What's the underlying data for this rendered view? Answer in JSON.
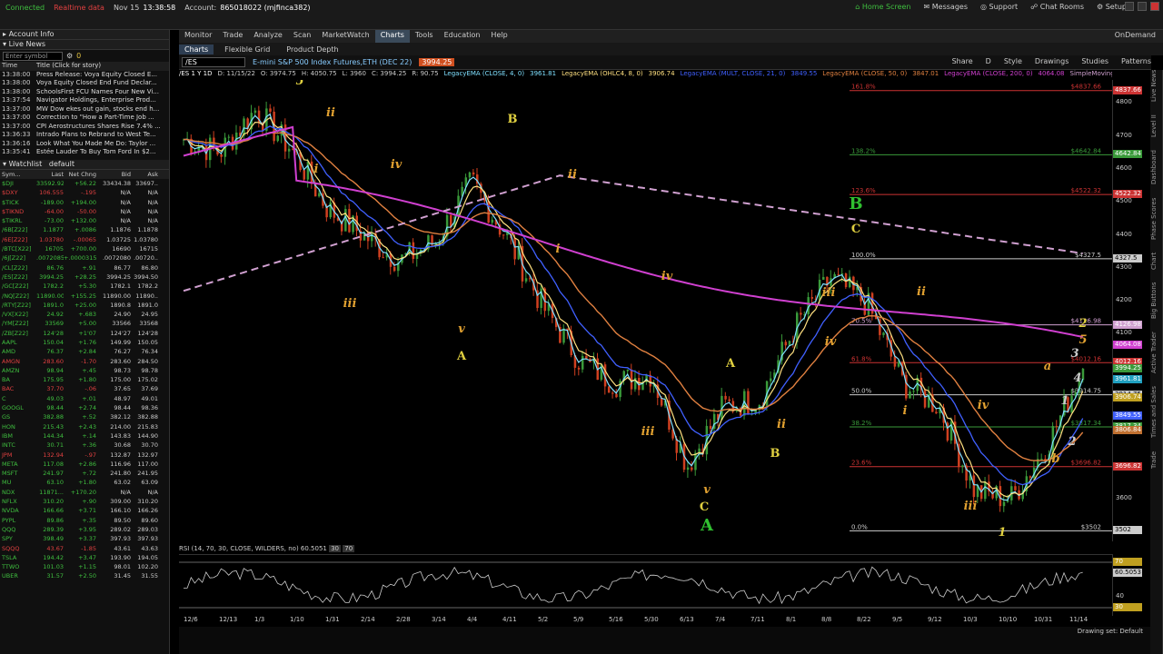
{
  "topbar": {
    "connected": "Connected",
    "realtime": "Realtime data",
    "date": "Nov 15",
    "time": "13:38:58",
    "account_label": "Account:",
    "account": "865018022 (mjfinca382)",
    "home": "Home Screen",
    "messages": "Messages",
    "support": "Support",
    "chat": "Chat Rooms",
    "setup": "Setup"
  },
  "menu": {
    "items": [
      "Monitor",
      "Trade",
      "Analyze",
      "Scan",
      "MarketWatch",
      "Charts",
      "Tools",
      "Education",
      "Help"
    ],
    "active": "Charts",
    "ondemand": "OnDemand"
  },
  "subtabs": {
    "items": [
      "Charts",
      "Flexible Grid",
      "Product Depth"
    ]
  },
  "charttool": {
    "symbol": "/ES",
    "desc": "E-mini S&P 500 Index Futures,ETH (DEC 22)",
    "price": "3994.25",
    "buttons": [
      "Share",
      "D",
      "Style",
      "Drawings",
      "Studies",
      "Patterns"
    ]
  },
  "legend": [
    {
      "t": "/ES 1 Y 1D",
      "c": "#ffffff"
    },
    {
      "t": "D: 11/15/22",
      "c": "#cccccc"
    },
    {
      "t": "O: 3974.75",
      "c": "#cccccc"
    },
    {
      "t": "H: 4050.75",
      "c": "#cccccc"
    },
    {
      "t": "L: 3960",
      "c": "#cccccc"
    },
    {
      "t": "C: 3994.25",
      "c": "#cccccc"
    },
    {
      "t": "R: 90.75",
      "c": "#cccccc"
    },
    {
      "t": "LegacyEMA (CLOSE, 4, 0)",
      "c": "#7fe0ff"
    },
    {
      "t": "3961.81",
      "c": "#7fe0ff"
    },
    {
      "t": "LegacyEMA (OHLC4, 8, 0)",
      "c": "#ffe080"
    },
    {
      "t": "3906.74",
      "c": "#ffe080"
    },
    {
      "t": "LegacyEMA (MULT, CLOSE, 21, 0)",
      "c": "#4060ff"
    },
    {
      "t": "3849.55",
      "c": "#4060ff"
    },
    {
      "t": "LegacyEMA (CLOSE, 50, 0)",
      "c": "#e08040"
    },
    {
      "t": "3847.01",
      "c": "#e08040"
    },
    {
      "t": "LegacyEMA (CLOSE, 200, 0)",
      "c": "#d040d0"
    },
    {
      "t": "4064.08",
      "c": "#d040d0"
    },
    {
      "t": "SimpleMovingAvg (CLOSE, 200, 0, no)",
      "c": "#d0a0d0"
    },
    {
      "t": "4126.98",
      "c": "#d0a0d0"
    }
  ],
  "accountinfo": "Account Info",
  "livenews": {
    "title": "Live News",
    "entersymbol": "Enter symbol",
    "count": "0",
    "col_time": "Time",
    "col_title": "Title (Click for story)",
    "rows": [
      [
        "13:38:00",
        "Press Release: Voya Equity Closed E..."
      ],
      [
        "13:38:00",
        "Voya Equity Closed End Fund Declar..."
      ],
      [
        "13:38:00",
        "SchoolsFirst FCU Names Four New Vi..."
      ],
      [
        "13:37:54",
        "Navigator Holdings, Enterprise Prod..."
      ],
      [
        "13:37:00",
        "MW Dow ekes out gain, stocks end h..."
      ],
      [
        "13:37:00",
        "Correction to \"How a Part-Time Job ..."
      ],
      [
        "13:37:00",
        "CPI Aerostructures Shares Rise 7.4% ..."
      ],
      [
        "13:36:33",
        "Intrado Plans to Rebrand to West Te..."
      ],
      [
        "13:36:16",
        "Look What You Made Me Do: Taylor ..."
      ],
      [
        "13:35:41",
        "Estée Lauder To Buy Tom Ford In $2..."
      ]
    ]
  },
  "watchlist": {
    "title": "Watchlist",
    "name": "default",
    "cols": [
      "Sym...",
      "Last",
      "Net Chng",
      "Bid",
      "Ask"
    ],
    "rows": [
      [
        "$DJI",
        "33592.92",
        "+56.22",
        "33434.38",
        "33697.."
      ],
      [
        "$DXY",
        "106.555",
        "-.195",
        "N/A",
        "N/A"
      ],
      [
        "$TICK",
        "-189.00",
        "+194.00",
        "N/A",
        "N/A"
      ],
      [
        "$TIKND",
        "-64.00",
        "-50.00",
        "N/A",
        "N/A"
      ],
      [
        "$TIKRL",
        "-73.00",
        "+132.00",
        "N/A",
        "N/A"
      ],
      [
        "/6B[Z22]",
        "1.1877",
        "+.0086",
        "1.1876",
        "1.1878"
      ],
      [
        "/6E[Z22]",
        "1.03780",
        "-.00065",
        "1.03725",
        "1.03780"
      ],
      [
        "/BTC[X22]",
        "16705",
        "+700.00",
        "16690",
        "16715"
      ],
      [
        "/6J[Z22]",
        ".0072085",
        "+.0000315",
        ".0072080",
        ".00720.."
      ],
      [
        "/CL[Z22]",
        "86.76",
        "+.91",
        "86.77",
        "86.80"
      ],
      [
        "/ES[Z22]",
        "3994.25",
        "+28.25",
        "3994.25",
        "3994.50"
      ],
      [
        "/GC[Z22]",
        "1782.2",
        "+5.30",
        "1782.1",
        "1782.2"
      ],
      [
        "/NQ[Z22]",
        "11890.00",
        "+155.25",
        "11890.00",
        "11890.."
      ],
      [
        "/RTY[Z22]",
        "1891.0",
        "+25.00",
        "1890.8",
        "1891.0"
      ],
      [
        "/VX[X22]",
        "24.92",
        "+.683",
        "24.90",
        "24.95"
      ],
      [
        "/YM[Z22]",
        "33569",
        "+5.00",
        "33566",
        "33568"
      ],
      [
        "/ZB[Z22]",
        "124'28",
        "+1'07",
        "124'27",
        "124'28"
      ],
      [
        "AAPL",
        "150.04",
        "+1.76",
        "149.99",
        "150.05"
      ],
      [
        "AMD",
        "76.37",
        "+2.84",
        "76.27",
        "76.34"
      ],
      [
        "AMGN",
        "283.60",
        "-1.70",
        "283.60",
        "284.50"
      ],
      [
        "AMZN",
        "98.94",
        "+.45",
        "98.73",
        "98.78"
      ],
      [
        "BA",
        "175.95",
        "+1.80",
        "175.00",
        "175.02"
      ],
      [
        "BAC",
        "37.70",
        "-.06",
        "37.65",
        "37.69"
      ],
      [
        "C",
        "49.03",
        "+.01",
        "48.97",
        "49.01"
      ],
      [
        "GOOGL",
        "98.44",
        "+2.74",
        "98.44",
        "98.36"
      ],
      [
        "GS",
        "382.88",
        "+.52",
        "382.12",
        "382.88"
      ],
      [
        "HON",
        "215.43",
        "+2.43",
        "214.00",
        "215.83"
      ],
      [
        "IBM",
        "144.34",
        "+.14",
        "143.83",
        "144.90"
      ],
      [
        "INTC",
        "30.71",
        "+.36",
        "30.68",
        "30.70"
      ],
      [
        "JPM",
        "132.94",
        "-.97",
        "132.87",
        "132.97"
      ],
      [
        "META",
        "117.08",
        "+2.86",
        "116.96",
        "117.00"
      ],
      [
        "MSFT",
        "241.97",
        "+.72",
        "241.80",
        "241.95"
      ],
      [
        "MU",
        "63.10",
        "+1.80",
        "63.02",
        "63.09"
      ],
      [
        "NDX",
        "11871...",
        "+170.20",
        "N/A",
        "N/A"
      ],
      [
        "NFLX",
        "310.20",
        "+.90",
        "309.00",
        "310.20"
      ],
      [
        "NVDA",
        "166.66",
        "+3.71",
        "166.10",
        "166.26"
      ],
      [
        "PYPL",
        "89.86",
        "+.35",
        "89.50",
        "89.60"
      ],
      [
        "QQQ",
        "289.39",
        "+3.95",
        "289.02",
        "289.03"
      ],
      [
        "SPY",
        "398.49",
        "+3.37",
        "397.93",
        "397.93"
      ],
      [
        "SQQQ",
        "43.67",
        "-1.85",
        "43.61",
        "43.63"
      ],
      [
        "TSLA",
        "194.42",
        "+3.47",
        "193.90",
        "194.05"
      ],
      [
        "TTWO",
        "101.03",
        "+1.15",
        "98.01",
        "102.20"
      ],
      [
        "UBER",
        "31.57",
        "+2.50",
        "31.45",
        "31.55"
      ]
    ]
  },
  "rightstrip": [
    "Trade",
    "Times and Sales",
    "Active Trader",
    "Big Buttons",
    "Chart",
    "Phase Scores",
    "Dashboard",
    "Level II",
    "Live News"
  ],
  "yaxis": {
    "ticks": [
      "4800",
      "4700",
      "4600",
      "4500",
      "4400",
      "4300",
      "4200",
      "4100",
      "4000",
      "3900",
      "3800",
      "3700",
      "3600",
      "3500"
    ],
    "badges": [
      {
        "t": "4837.66",
        "c": "#cc3333",
        "y": 4837.66
      },
      {
        "t": "4642.84",
        "c": "#3a9a3a",
        "y": 4642.84
      },
      {
        "t": "4522.32",
        "c": "#cc3333",
        "y": 4522.32
      },
      {
        "t": "4327.5",
        "c": "#cccccc",
        "y": 4327.5
      },
      {
        "t": "4126.98",
        "c": "#d0a0d0",
        "y": 4126.98
      },
      {
        "t": "4064.08",
        "c": "#d040d0",
        "y": 4064.08
      },
      {
        "t": "4012.16",
        "c": "#cc3333",
        "y": 4012.16
      },
      {
        "t": "3994.25",
        "c": "#3a9a3a",
        "y": 3994.25
      },
      {
        "t": "3961.81",
        "c": "#20a0c0",
        "y": 3961.81
      },
      {
        "t": "3914.75",
        "c": "#cccccc",
        "y": 3914.75
      },
      {
        "t": "3906.74",
        "c": "#c0a020",
        "y": 3906.74
      },
      {
        "t": "3849.55",
        "c": "#4060ff",
        "y": 3849.55
      },
      {
        "t": "3817.34",
        "c": "#3a9a3a",
        "y": 3817.34
      },
      {
        "t": "3806.84",
        "c": "#c07030",
        "y": 3806.84
      },
      {
        "t": "3696.82",
        "c": "#cc3333",
        "y": 3696.82
      },
      {
        "t": "3502",
        "c": "#cccccc",
        "y": 3502
      }
    ]
  },
  "fib": [
    {
      "label": "161.8%",
      "val": 4837.66,
      "c": "#cc3333"
    },
    {
      "label": "138.2%",
      "val": 4642.84,
      "c": "#3a9a3a"
    },
    {
      "label": "123.6%",
      "val": 4522.32,
      "c": "#cc3333"
    },
    {
      "label": "100.0%",
      "val": 4327.5,
      "c": "#cccccc"
    },
    {
      "label": "70.5%",
      "val": 4126.98,
      "c": "#d0a0d0"
    },
    {
      "label": "61.8%",
      "val": 4012.16,
      "c": "#cc3333"
    },
    {
      "label": "50.0%",
      "val": 3914.75,
      "c": "#cccccc"
    },
    {
      "label": "38.2%",
      "val": 3817.34,
      "c": "#3a9a3a"
    },
    {
      "label": "23.6%",
      "val": 3696.82,
      "c": "#cc3333"
    },
    {
      "label": "0.0%",
      "val": 3502,
      "c": "#cccccc"
    }
  ],
  "fibvals": [
    "$4837.66",
    "$4642.84",
    "$4522.32",
    "$4327.5",
    "$4126.98",
    "$4012.16",
    "$3914.75",
    "$3817.34",
    "$3696.82",
    "$3502"
  ],
  "chart_data": {
    "type": "line",
    "title": "",
    "ylim": [
      3470,
      4870
    ],
    "x": [
      "12/6",
      "12/13",
      "1/3",
      "1/10",
      "1/31",
      "2/14",
      "2/28",
      "3/14",
      "4/4",
      "4/11",
      "5/2",
      "5/9",
      "5/16",
      "5/30",
      "6/13",
      "7/4",
      "7/11",
      "8/1",
      "8/8",
      "8/22",
      "9/5",
      "9/12",
      "10/3",
      "10/10",
      "10/31",
      "11/14"
    ],
    "series": [
      {
        "name": "/ES",
        "values": [
          4690,
          4650,
          4780,
          4660,
          4480,
          4400,
          4320,
          4380,
          4560,
          4390,
          4180,
          4020,
          3950,
          3980,
          3700,
          3880,
          3900,
          4120,
          4270,
          4190,
          3950,
          3880,
          3620,
          3600,
          3760,
          3994
        ]
      }
    ]
  },
  "waves": [
    {
      "t": "5",
      "c": "#e0d040",
      "x": 330,
      "y": 93
    },
    {
      "t": "ii",
      "c": "#e0a030",
      "x": 364,
      "y": 128
    },
    {
      "t": "i",
      "c": "#e0a030",
      "x": 348,
      "y": 190
    },
    {
      "t": "iv",
      "c": "#e0a030",
      "x": 436,
      "y": 185
    },
    {
      "t": "iii",
      "c": "#e0a030",
      "x": 385,
      "y": 338
    },
    {
      "t": "v",
      "c": "#e0a030",
      "x": 508,
      "y": 366
    },
    {
      "t": "A",
      "c": "#e0d040",
      "x": 508,
      "y": 396
    },
    {
      "t": "B",
      "c": "#e0d040",
      "x": 564,
      "y": 135
    },
    {
      "t": "ii",
      "c": "#e0a030",
      "x": 630,
      "y": 196
    },
    {
      "t": "i",
      "c": "#e0a030",
      "x": 614,
      "y": 278
    },
    {
      "t": "iv",
      "c": "#e0a030",
      "x": 734,
      "y": 308
    },
    {
      "t": "iii",
      "c": "#e0a030",
      "x": 713,
      "y": 479
    },
    {
      "t": "v",
      "c": "#e0a030",
      "x": 778,
      "y": 543
    },
    {
      "t": "C",
      "c": "#e0d040",
      "x": 775,
      "y": 562
    },
    {
      "t": "A",
      "c": "#30c030",
      "x": 778,
      "y": 584
    },
    {
      "t": "A",
      "c": "#e0d040",
      "x": 804,
      "y": 404
    },
    {
      "t": "ii",
      "c": "#e0a030",
      "x": 860,
      "y": 471
    },
    {
      "t": "B",
      "c": "#e0d040",
      "x": 853,
      "y": 503
    },
    {
      "t": "iii",
      "c": "#e0a030",
      "x": 912,
      "y": 326
    },
    {
      "t": "iv",
      "c": "#e0a030",
      "x": 914,
      "y": 380
    },
    {
      "t": "B",
      "c": "#30c030",
      "x": 942,
      "y": 230
    },
    {
      "t": "C",
      "c": "#e0d040",
      "x": 942,
      "y": 256
    },
    {
      "t": "ii",
      "c": "#e0a030",
      "x": 1014,
      "y": 325
    },
    {
      "t": "i",
      "c": "#e0a030",
      "x": 996,
      "y": 456
    },
    {
      "t": "iv",
      "c": "#e0a030",
      "x": 1082,
      "y": 450
    },
    {
      "t": "iii",
      "c": "#e0a030",
      "x": 1068,
      "y": 561
    },
    {
      "t": "1",
      "c": "#e0d040",
      "x": 1103,
      "y": 590
    },
    {
      "t": "a",
      "c": "#e0a030",
      "x": 1153,
      "y": 407
    },
    {
      "t": "b",
      "c": "#e0a030",
      "x": 1162,
      "y": 509
    },
    {
      "t": "1",
      "c": "#cccccc",
      "x": 1172,
      "y": 445
    },
    {
      "t": "2",
      "c": "#cccccc",
      "x": 1180,
      "y": 490
    },
    {
      "t": "3",
      "c": "#cccccc",
      "x": 1183,
      "y": 393
    },
    {
      "t": "4",
      "c": "#cccccc",
      "x": 1186,
      "y": 420
    },
    {
      "t": "5",
      "c": "#e0a030",
      "x": 1192,
      "y": 378
    },
    {
      "t": "2",
      "c": "#e0d040",
      "x": 1192,
      "y": 360
    }
  ],
  "rsi": {
    "label": "RSI (14, 70, 30, CLOSE, WILDERS, no)",
    "value": "60.5051",
    "ob": "30",
    "os": "70",
    "badge": "60.5053",
    "t1": "70",
    "t2": "40",
    "t3": "30"
  },
  "bottom": {
    "drawset": "Drawing set: Default"
  }
}
